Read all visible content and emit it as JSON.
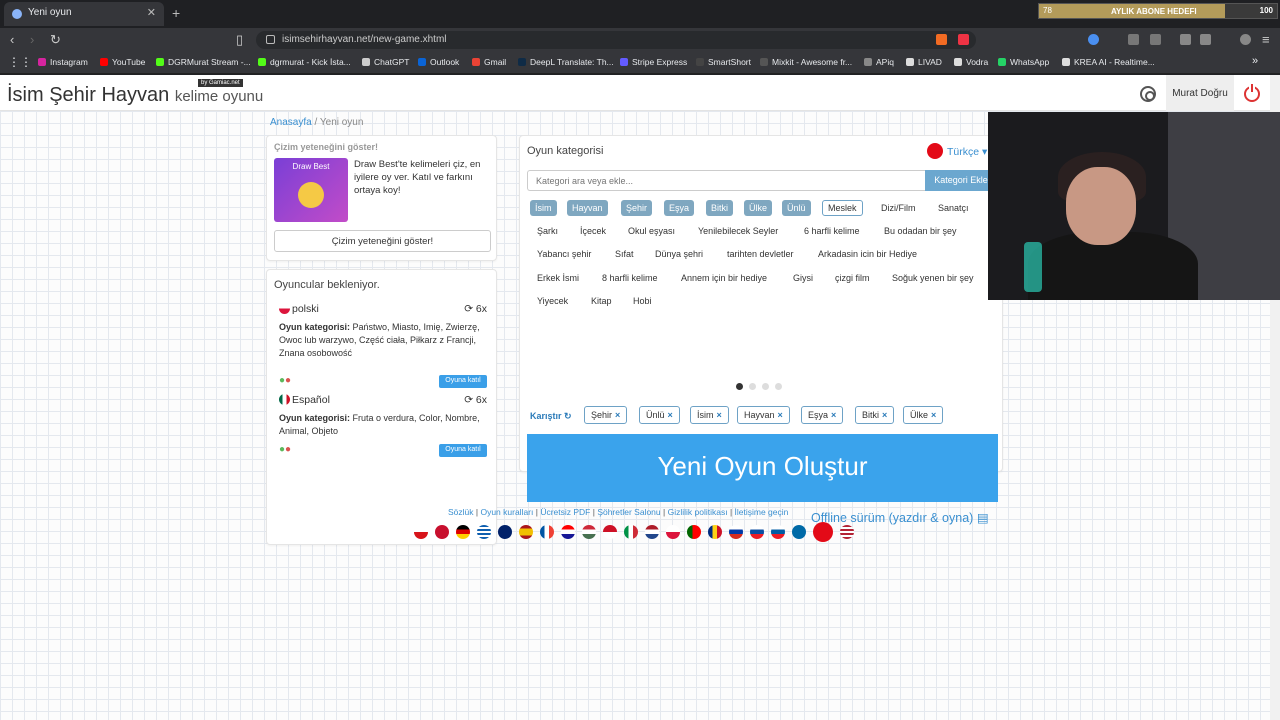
{
  "browser": {
    "tab_title": "Yeni oyun",
    "tab_close": "✕",
    "new_tab": "+",
    "url": "isimsehirhayvan.net/new-game.xhtml",
    "goal": {
      "current": "78",
      "label": "AYLIK ABONE HEDEFI",
      "target": "100",
      "progress": 0.78
    },
    "bookmarks": [
      {
        "label": "Instagram",
        "color": "#d6249f"
      },
      {
        "label": "YouTube",
        "color": "#ff0000"
      },
      {
        "label": "DGRMurat Stream -...",
        "color": "#53fc18"
      },
      {
        "label": "dgrmurat - Kick İsta...",
        "color": "#53fc18"
      },
      {
        "label": "ChatGPT",
        "color": "#cccccc"
      },
      {
        "label": "Outlook",
        "color": "#0a64d6"
      },
      {
        "label": "Gmail",
        "color": "#ea4335"
      },
      {
        "label": "DeepL Translate: Th...",
        "color": "#0f2b46"
      },
      {
        "label": "Stripe Express",
        "color": "#635bff"
      },
      {
        "label": "SmartShort",
        "color": "#444444"
      },
      {
        "label": "Mixkit - Awesome fr...",
        "color": "#555555"
      },
      {
        "label": "APiq",
        "color": "#888888"
      },
      {
        "label": "LIVAD",
        "color": "#dddddd"
      },
      {
        "label": "Vodra",
        "color": "#dddddd"
      },
      {
        "label": "WhatsApp",
        "color": "#25d366"
      },
      {
        "label": "KREA AI - Realtime...",
        "color": "#dddddd"
      }
    ]
  },
  "header": {
    "logo_main": "İsim Şehir Hayvan",
    "logo_sub": "kelime oyunu",
    "byline": "by Gamiac.net",
    "user_name": "Murat Doğru"
  },
  "breadcrumb": {
    "home": "Anasayfa",
    "separator": "/",
    "current": "Yeni oyun"
  },
  "draw_card": {
    "heading": "Çizim yeteneğini göster!",
    "image_label": "Draw Best",
    "text": "Draw Best'te kelimeleri çiz, en iyilere oy ver. Katıl ve farkını ortaya koy!",
    "button": "Çizim yeteneğini göster!"
  },
  "players": {
    "heading": "Oyuncular bekleniyor.",
    "games": [
      {
        "language": "polski",
        "count": "6x",
        "cats_label": "Oyun kategorisi:",
        "cats": "Państwo, Miasto, Imię, Zwierzę, Owoc lub warzywo, Część ciała, Piłkarz z Francji, Znana osobowość",
        "join": "Oyuna katıl"
      },
      {
        "language": "Español",
        "count": "6x",
        "cats_label": "Oyun kategorisi:",
        "cats": "Fruta o verdura, Color, Nombre, Animal, Objeto",
        "join": "Oyuna katıl"
      }
    ]
  },
  "main": {
    "heading": "Oyun kategorisi",
    "language": "Türkçe ▾",
    "search_placeholder": "Kategori ara veya ekle...",
    "add_button": "Kategori Ekle",
    "chips": [
      "İsim",
      "Hayvan",
      "Şehir",
      "Eşya",
      "Bitki",
      "Ülke",
      "Ünlü",
      "Meslek",
      "Dizi/Film",
      "Sanatçı",
      "Şarkı",
      "İçecek",
      "Okul eşyası",
      "Yenilebilecek Seyler",
      "6 harfli kelime",
      "Bu odadan bir şey",
      "Yabancı şehir",
      "Sıfat",
      "Dünya şehri",
      "tarihten devletler",
      "Arkadasin icin bir Hediye",
      "Erkek İsmi",
      "8 harfli kelime",
      "Annem için bir hediye",
      "Giysi",
      "çizgi film",
      "Soğuk yenen bir şey",
      "Yiyecek",
      "Kitap",
      "Hobi"
    ],
    "shuffle": "Karıştır ↻",
    "selected": [
      "Şehir",
      "Ünlü",
      "İsim",
      "Hayvan",
      "Eşya",
      "Bitki",
      "Ülke"
    ],
    "remove_glyph": "×",
    "new_game": "Yeni Oyun Oluştur",
    "offline": "Offline sürüm (yazdır & oyna)"
  },
  "footer": {
    "links": [
      "Sözlük",
      "Oyun kuralları",
      "Ücretsiz PDF",
      "Şöhretler Salonu",
      "Gizlilik politikası",
      "İletişime geçin"
    ],
    "separator": " | "
  },
  "colors": {
    "accent": "#3aa3ec",
    "chip_selected": "#7fa7c0",
    "link": "#3a8fd0"
  }
}
